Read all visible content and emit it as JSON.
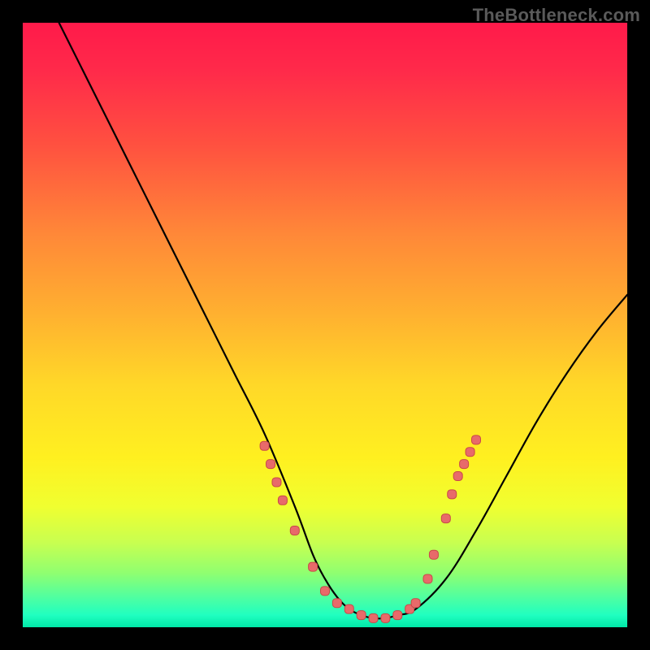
{
  "watermark": "TheBottleneck.com",
  "chart_data": {
    "type": "line",
    "title": "",
    "xlabel": "",
    "ylabel": "",
    "xlim": [
      0,
      100
    ],
    "ylim": [
      0,
      100
    ],
    "series": [
      {
        "name": "curve",
        "x": [
          6,
          10,
          15,
          20,
          25,
          30,
          35,
          40,
          45,
          48,
          50,
          52,
          54,
          56,
          58,
          60,
          62,
          65,
          70,
          75,
          80,
          85,
          90,
          95,
          100
        ],
        "y": [
          100,
          92,
          82,
          72,
          62,
          52,
          42,
          32,
          20,
          12,
          8,
          5,
          3,
          2,
          1.5,
          1.5,
          2,
          3,
          8,
          16,
          25,
          34,
          42,
          49,
          55
        ]
      }
    ],
    "markers": {
      "name": "highlight-points",
      "x": [
        40,
        41,
        42,
        43,
        45,
        48,
        50,
        52,
        54,
        56,
        58,
        60,
        62,
        64,
        65,
        67,
        68,
        70,
        71,
        72,
        73,
        74,
        75
      ],
      "y": [
        30,
        27,
        24,
        21,
        16,
        10,
        6,
        4,
        3,
        2,
        1.5,
        1.5,
        2,
        3,
        4,
        8,
        12,
        18,
        22,
        25,
        27,
        29,
        31
      ]
    },
    "gradient_stops": [
      {
        "offset": 0,
        "color": "#ff1a4a"
      },
      {
        "offset": 35,
        "color": "#ff8838"
      },
      {
        "offset": 60,
        "color": "#ffd828"
      },
      {
        "offset": 80,
        "color": "#f0ff30"
      },
      {
        "offset": 95,
        "color": "#50ffa0"
      },
      {
        "offset": 100,
        "color": "#00e8a8"
      }
    ]
  }
}
